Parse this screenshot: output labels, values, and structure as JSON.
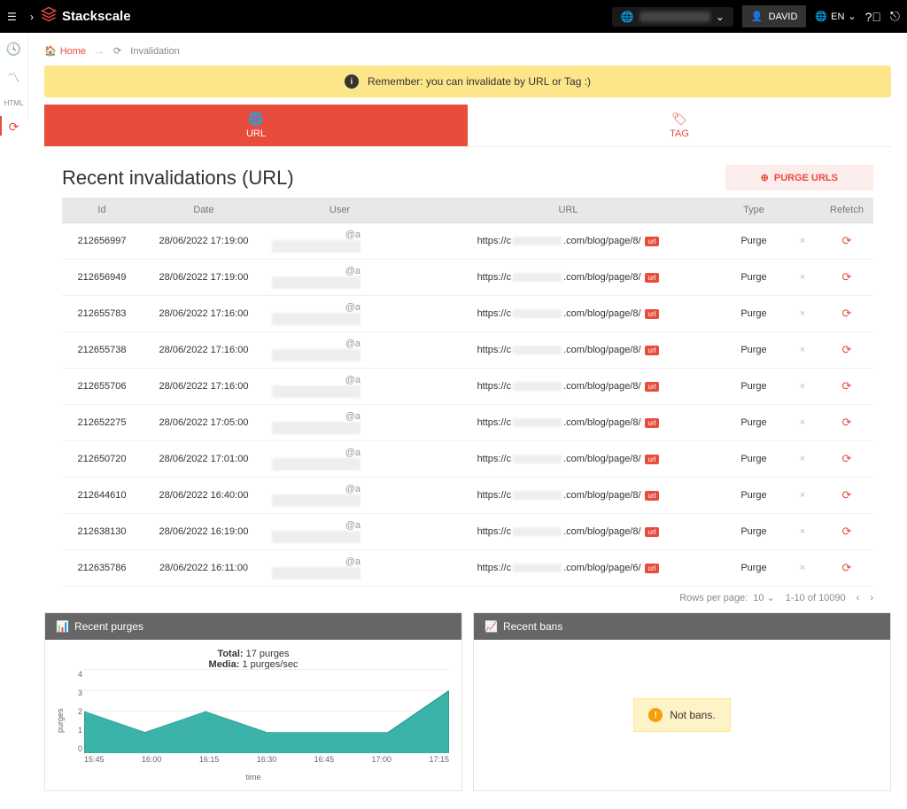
{
  "topbar": {
    "logo_text": "Stackscale",
    "user_label": "DAVID",
    "lang_label": "EN"
  },
  "breadcrumb": {
    "home": "Home",
    "current": "Invalidation"
  },
  "banner": {
    "text": "Remember: you can invalidate by URL or Tag :)"
  },
  "tabs": {
    "url": "URL",
    "tag": "TAG"
  },
  "section": {
    "title": "Recent invalidations (URL)",
    "purge_btn": "PURGE URLS"
  },
  "table": {
    "headers": {
      "id": "Id",
      "date": "Date",
      "user": "User",
      "url": "URL",
      "type": "Type",
      "refetch": "Refetch"
    },
    "rows": [
      {
        "id": "212656997",
        "date": "28/06/2022 17:19:00",
        "user_prefix": "@a",
        "url_prefix": "https://c",
        "url_suffix": ".com/blog/page/8/",
        "type": "Purge"
      },
      {
        "id": "212656949",
        "date": "28/06/2022 17:19:00",
        "user_prefix": "@a",
        "url_prefix": "https://c",
        "url_suffix": ".com/blog/page/8/",
        "type": "Purge"
      },
      {
        "id": "212655783",
        "date": "28/06/2022 17:16:00",
        "user_prefix": "@a",
        "url_prefix": "https://c",
        "url_suffix": ".com/blog/page/8/",
        "type": "Purge"
      },
      {
        "id": "212655738",
        "date": "28/06/2022 17:16:00",
        "user_prefix": "@a",
        "url_prefix": "https://c",
        "url_suffix": ".com/blog/page/8/",
        "type": "Purge"
      },
      {
        "id": "212655706",
        "date": "28/06/2022 17:16:00",
        "user_prefix": "@a",
        "url_prefix": "https://c",
        "url_suffix": ".com/blog/page/8/",
        "type": "Purge"
      },
      {
        "id": "212652275",
        "date": "28/06/2022 17:05:00",
        "user_prefix": "@a",
        "url_prefix": "https://c",
        "url_suffix": ".com/blog/page/8/",
        "type": "Purge"
      },
      {
        "id": "212650720",
        "date": "28/06/2022 17:01:00",
        "user_prefix": "@a",
        "url_prefix": "https://c",
        "url_suffix": ".com/blog/page/8/",
        "type": "Purge"
      },
      {
        "id": "212644610",
        "date": "28/06/2022 16:40:00",
        "user_prefix": "@a",
        "url_prefix": "https://c",
        "url_suffix": ".com/blog/page/8/",
        "type": "Purge"
      },
      {
        "id": "212638130",
        "date": "28/06/2022 16:19:00",
        "user_prefix": "@a",
        "url_prefix": "https://c",
        "url_suffix": ".com/blog/page/8/",
        "type": "Purge"
      },
      {
        "id": "212635786",
        "date": "28/06/2022 16:11:00",
        "user_prefix": "@a",
        "url_prefix": "https://c",
        "url_suffix": ".com/blog/page/6/",
        "type": "Purge"
      }
    ]
  },
  "pagination": {
    "rows_label": "Rows per page:",
    "rows_value": "10",
    "range": "1-10 of 10090"
  },
  "panels": {
    "purges_title": "Recent purges",
    "bans_title": "Recent bans",
    "not_bans": "Not bans.",
    "chart_total_label": "Total:",
    "chart_total_value": "17 purges",
    "chart_media_label": "Media:",
    "chart_media_value": "1 purges/sec",
    "ylabel": "purges",
    "xlabel": "time"
  },
  "chart_data": {
    "type": "area",
    "title": "Recent purges",
    "xlabel": "time",
    "ylabel": "purges",
    "ylim": [
      0,
      4
    ],
    "x": [
      "15:45",
      "16:00",
      "16:15",
      "16:30",
      "16:45",
      "17:00",
      "17:15"
    ],
    "values": [
      2,
      1,
      2,
      1,
      1,
      1,
      3
    ],
    "y_ticks": [
      0,
      1,
      2,
      3,
      4
    ]
  }
}
